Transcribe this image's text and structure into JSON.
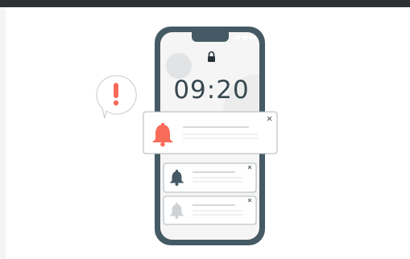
{
  "lockscreen": {
    "time": "09:20"
  },
  "colors": {
    "phone_frame": "#455a64",
    "screen": "#f5f5f5",
    "accent": "#f76b5a",
    "bell_dark": "#455a64",
    "bell_light": "#cfd2d4",
    "card_border": "#b0b6ba"
  },
  "notifications": [
    {
      "icon": "bell-icon",
      "state": "highlighted"
    },
    {
      "icon": "bell-icon",
      "state": "normal"
    },
    {
      "icon": "bell-icon",
      "state": "faded"
    }
  ],
  "alert_bubble": {
    "icon": "exclamation-icon"
  }
}
